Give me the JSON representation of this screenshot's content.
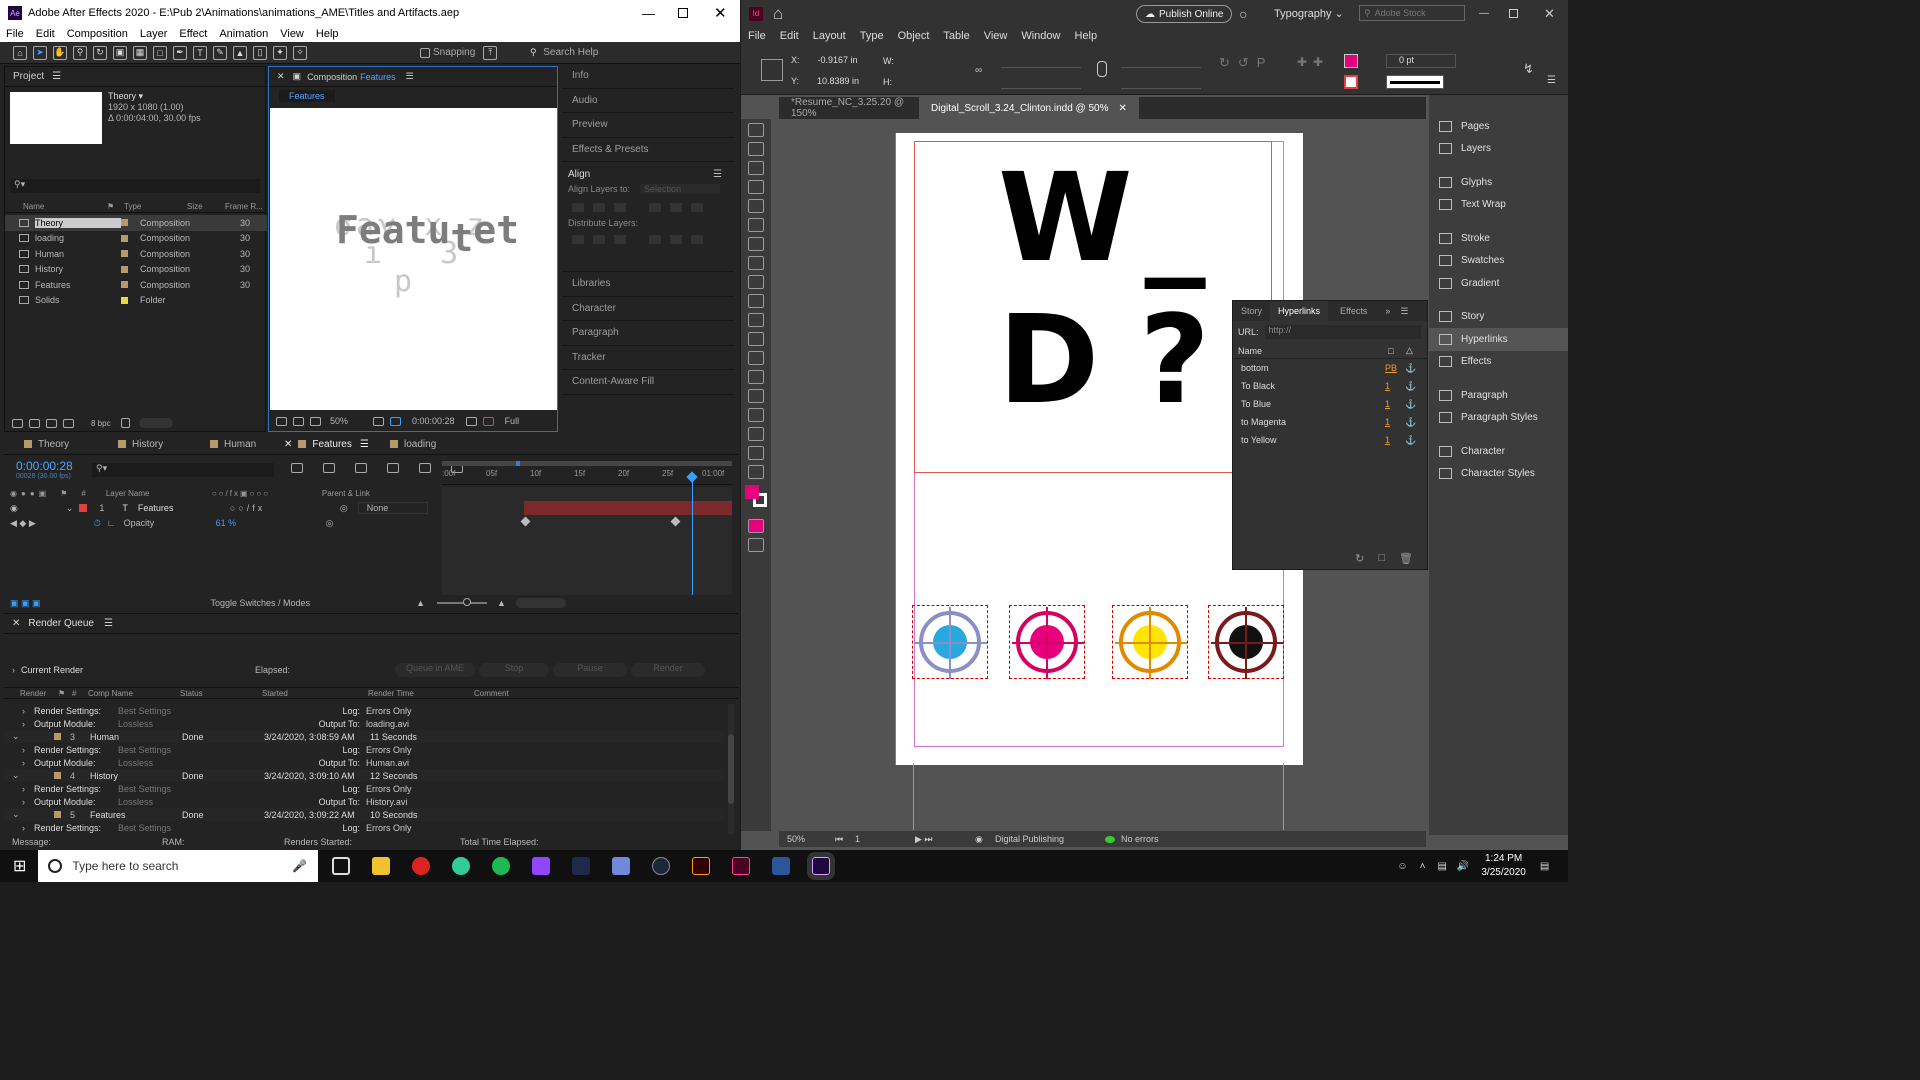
{
  "ae": {
    "title": "Adobe After Effects 2020 - E:\\Pub 2\\Animations\\animations_AME\\Titles and Artifacts.aep",
    "menu": [
      "File",
      "Edit",
      "Composition",
      "Layer",
      "Effect",
      "Animation",
      "View",
      "Help"
    ],
    "snapping": "Snapping",
    "search_help": "Search Help",
    "project": {
      "tab": "Project",
      "comp_name": "Theory ▾",
      "comp_size": "1920 x 1080 (1.00)",
      "comp_dur": "Δ 0:00:04:00, 30.00 fps",
      "headers": [
        "Name",
        "Type",
        "Size",
        "Frame R..."
      ],
      "items": [
        {
          "name": "Theory",
          "type": "Composition",
          "rate": "30",
          "color": "#b89a6a"
        },
        {
          "name": "loading",
          "type": "Composition",
          "rate": "30",
          "color": "#b89a6a"
        },
        {
          "name": "Human",
          "type": "Composition",
          "rate": "30",
          "color": "#b89a6a"
        },
        {
          "name": "History",
          "type": "Composition",
          "rate": "30",
          "color": "#b89a6a"
        },
        {
          "name": "Features",
          "type": "Composition",
          "rate": "30",
          "color": "#b89a6a"
        },
        {
          "name": "Solids",
          "type": "Folder",
          "rate": "",
          "color": "#e8d84a"
        }
      ],
      "bpc": "8 bpc"
    },
    "comp": {
      "tab_prefix": "Composition",
      "tab_name": "Features",
      "crumb": "Features",
      "preview_text": "Featu",
      "preview_text2": "t",
      "preview_text3": "et",
      "zoom": "50%",
      "time": "0:00:00:28",
      "quality": "Full"
    },
    "right_panels": [
      "Info",
      "Audio",
      "Preview",
      "Effects & Presets"
    ],
    "align": {
      "title": "Align",
      "align_to_label": "Align Layers to:",
      "align_to_value": "Selection",
      "distribute": "Distribute Layers:"
    },
    "right_panels2": [
      "Libraries",
      "Character",
      "Paragraph",
      "Tracker",
      "Content-Aware Fill"
    ],
    "tl_tabs": [
      "Theory",
      "History",
      "Human",
      "Features",
      "loading"
    ],
    "timeline": {
      "timecode": "0:00:00:28",
      "sub": "00028 (30.00 fps)",
      "ruler": [
        ":00f",
        "05f",
        "10f",
        "15f",
        "20f",
        "25f",
        "01:00f"
      ],
      "cols": {
        "num": "#",
        "layer": "Layer Name",
        "parent": "Parent & Link"
      },
      "layer": {
        "num": "1",
        "name": "Features",
        "parent": "None"
      },
      "prop": {
        "name": "Opacity",
        "value": "61 %"
      },
      "toggle": "Toggle Switches / Modes"
    },
    "rq": {
      "title": "Render Queue",
      "current": "Current Render",
      "elapsed": "Elapsed:",
      "buttons": [
        "Queue in AME",
        "Stop",
        "Pause",
        "Render"
      ],
      "headers": [
        "Render",
        "#",
        "Comp Name",
        "Status",
        "Started",
        "Render Time",
        "Comment"
      ],
      "rs": "Render Settings:",
      "best": "Best Settings",
      "om": "Output Module:",
      "lossless": "Lossless",
      "log": "Log:",
      "errors": "Errors Only",
      "out": "Output To:",
      "items": [
        {
          "num": "",
          "name": "",
          "status": "",
          "started": "",
          "time": "",
          "file": "loading.avi"
        },
        {
          "num": "3",
          "name": "Human",
          "status": "Done",
          "started": "3/24/2020, 3:08:59 AM",
          "time": "11 Seconds",
          "file": "Human.avi"
        },
        {
          "num": "4",
          "name": "History",
          "status": "Done",
          "started": "3/24/2020, 3:09:10 AM",
          "time": "12 Seconds",
          "file": "History.avi"
        },
        {
          "num": "5",
          "name": "Features",
          "status": "Done",
          "started": "3/24/2020, 3:09:22 AM",
          "time": "10 Seconds",
          "file": ""
        }
      ],
      "footer": {
        "message": "Message:",
        "ram": "RAM:",
        "renders": "Renders Started:",
        "total": "Total Time Elapsed:"
      }
    }
  },
  "id": {
    "publish": "Publish Online",
    "workspace": "Typography",
    "stock": "Adobe Stock",
    "menu": [
      "File",
      "Edit",
      "Layout",
      "Type",
      "Object",
      "Table",
      "View",
      "Window",
      "Help"
    ],
    "ctrl": {
      "x_label": "X:",
      "x": "-0.9167 in",
      "y_label": "Y:",
      "y": "10.8389 in",
      "w": "W:",
      "h": "H:",
      "stroke": "0 pt"
    },
    "tabs": [
      {
        "label": "*Resume_NC_3.25.20 @ 150%",
        "active": false
      },
      {
        "label": "Digital_Scroll_3.24_Clinton.indd @ 50%",
        "active": true
      }
    ],
    "page": {
      "line1": "W_",
      "line2": "D?"
    },
    "targets": [
      {
        "fill": "#29a8e0",
        "ring": "#8b8fc8"
      },
      {
        "fill": "#e6007e",
        "ring": "#d8005f"
      },
      {
        "fill": "#ffe500",
        "ring": "#e08a00"
      },
      {
        "fill": "#111111",
        "ring": "#7a1a1a"
      }
    ],
    "hyperlinks": {
      "tabs": [
        "Story",
        "Hyperlinks",
        "Effects"
      ],
      "url_label": "URL:",
      "url": "http://",
      "col": "Name",
      "rows": [
        {
          "name": "bottom",
          "val": "PB"
        },
        {
          "name": "To Black",
          "val": "1"
        },
        {
          "name": "To Blue",
          "val": "1"
        },
        {
          "name": "to Magenta",
          "val": "1"
        },
        {
          "name": "to Yellow",
          "val": "1"
        }
      ]
    },
    "right_panel": [
      "Pages",
      "Layers",
      "Glyphs",
      "Text Wrap",
      "Stroke",
      "Swatches",
      "Gradient",
      "Story",
      "Hyperlinks",
      "Effects",
      "Paragraph",
      "Paragraph Styles",
      "Character",
      "Character Styles"
    ],
    "status": {
      "zoom": "50%",
      "page": "1",
      "profile": "Digital Publishing",
      "errors": "No errors"
    }
  },
  "taskbar": {
    "search": "Type here to search",
    "time": "1:24 PM",
    "date": "3/25/2020"
  }
}
